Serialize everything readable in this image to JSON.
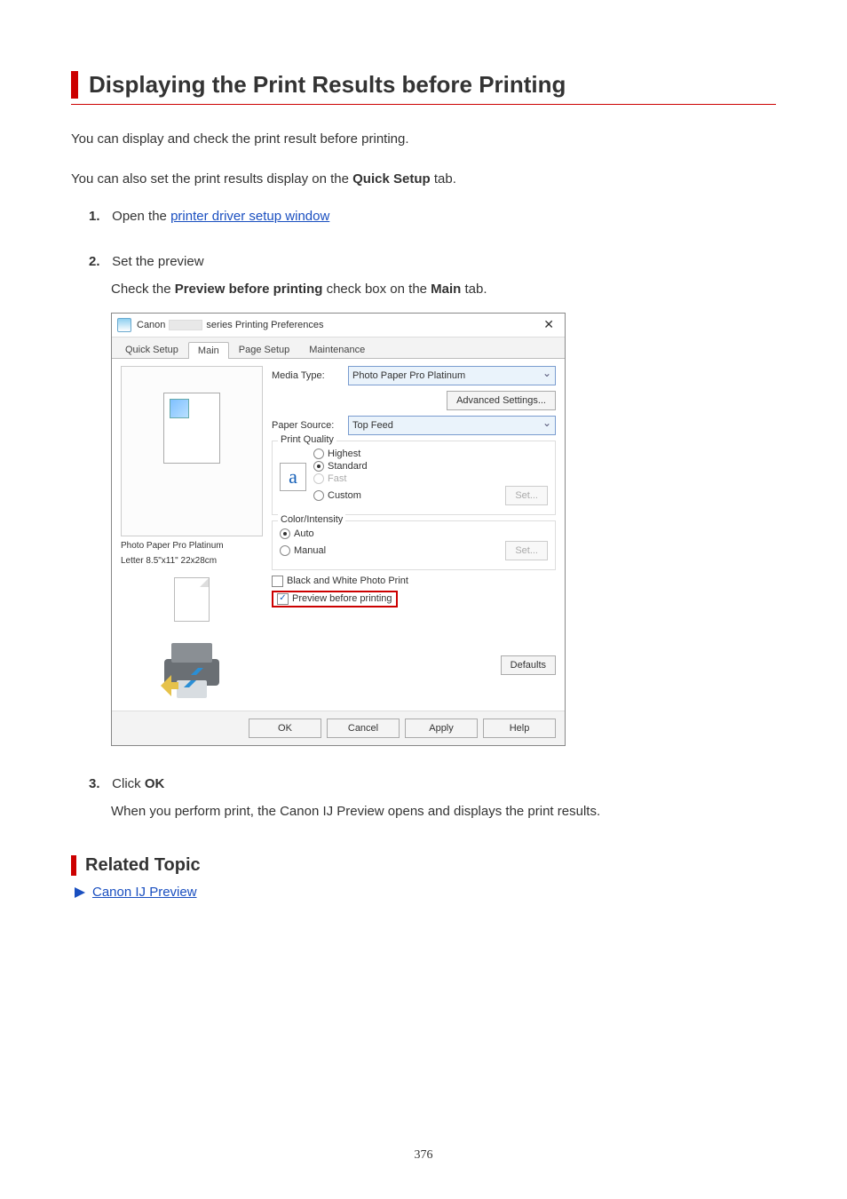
{
  "title": "Displaying the Print Results before Printing",
  "intro1": "You can display and check the print result before printing.",
  "intro2_pre": "You can also set the print results display on the ",
  "intro2_bold": "Quick Setup",
  "intro2_post": " tab.",
  "steps": {
    "s1": {
      "num": "1.",
      "text": "Open the ",
      "link": "printer driver setup window"
    },
    "s2": {
      "num": "2.",
      "title": "Set the preview",
      "sub_pre": "Check the ",
      "sub_b1": "Preview before printing",
      "sub_mid": " check box on the ",
      "sub_b2": "Main",
      "sub_post": " tab."
    },
    "s3": {
      "num": "3.",
      "text_pre": "Click ",
      "text_b": "OK",
      "sub": "When you perform print, the Canon IJ Preview opens and displays the print results."
    }
  },
  "win": {
    "title_pre": "Canon",
    "title_post": "series Printing Preferences",
    "close": "✕",
    "tabs": {
      "quick": "Quick Setup",
      "main": "Main",
      "page": "Page Setup",
      "maint": "Maintenance"
    },
    "labels": {
      "media": "Media Type:",
      "paper_source": "Paper Source:",
      "print_quality": "Print Quality",
      "color_intensity": "Color/Intensity"
    },
    "values": {
      "media": "Photo Paper Pro Platinum",
      "paper_source": "Top Feed"
    },
    "buttons": {
      "advanced": "Advanced Settings...",
      "set": "Set...",
      "defaults": "Defaults",
      "ok": "OK",
      "cancel": "Cancel",
      "apply": "Apply",
      "help": "Help"
    },
    "quality": {
      "highest": "Highest",
      "standard": "Standard",
      "fast": "Fast",
      "custom": "Custom"
    },
    "color": {
      "auto": "Auto",
      "manual": "Manual"
    },
    "cb_bw": "Black and White Photo Print",
    "cb_preview": "Preview before printing",
    "caption1": "Photo Paper Pro Platinum",
    "caption2": "Letter 8.5\"x11\" 22x28cm",
    "a_letter": "a"
  },
  "related": {
    "heading": "Related Topic",
    "link": "Canon IJ Preview"
  },
  "pagenum": "376"
}
